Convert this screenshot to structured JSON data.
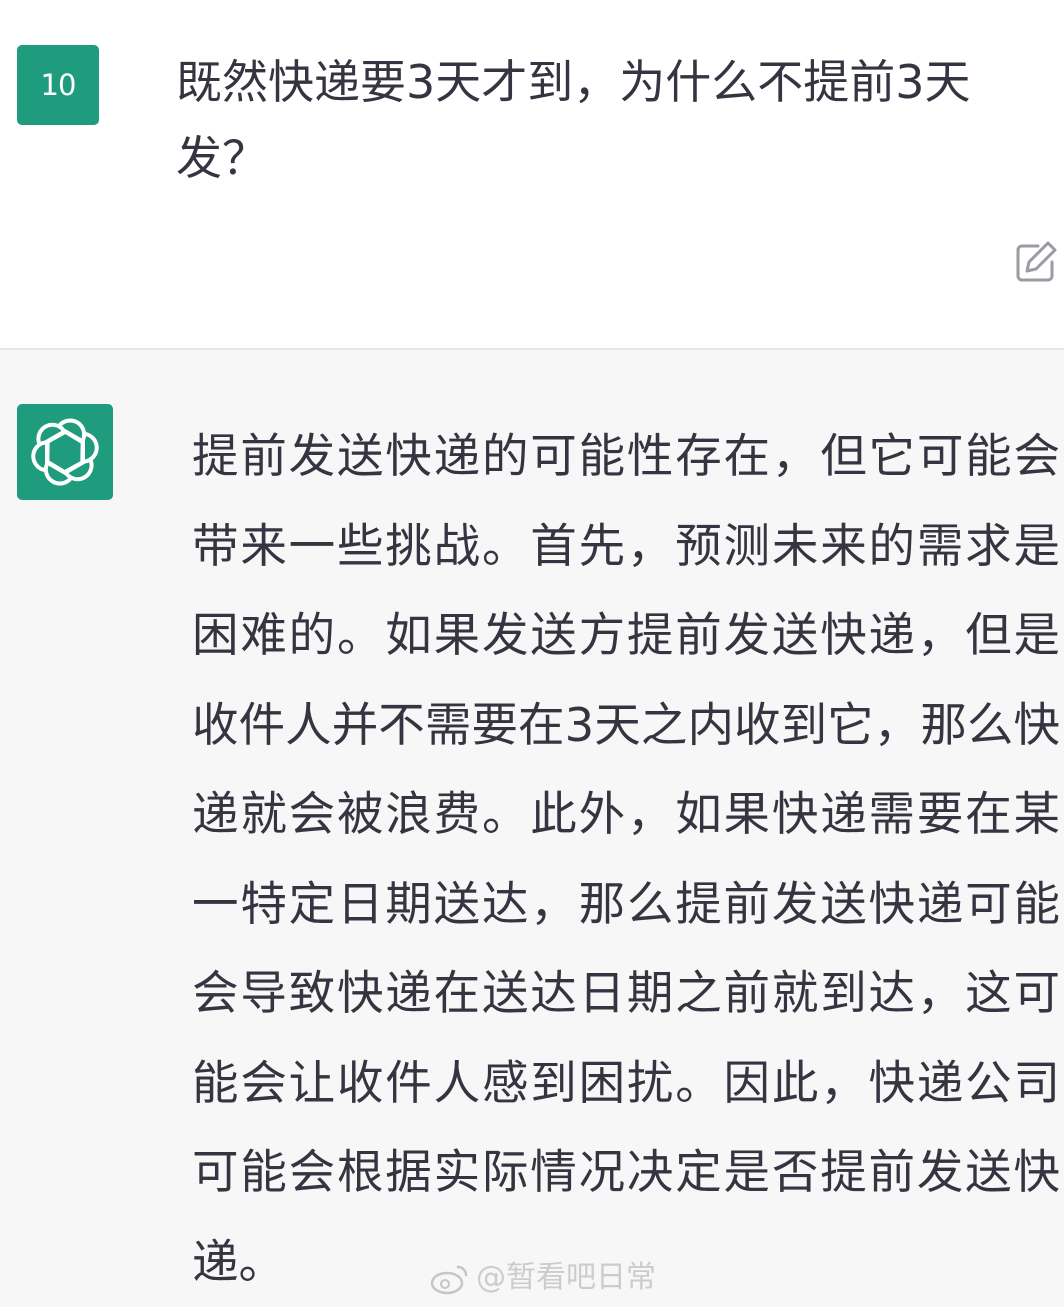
{
  "user": {
    "avatar_text": "10",
    "message": "既然快递要3天才到，为什么不提前3天发？",
    "edit_icon": "edit-icon"
  },
  "assistant": {
    "avatar_icon": "openai-logo-icon",
    "message": "提前发送快递的可能性存在，但它可能会带来一些挑战。首先，预测未来的需求是困难的。如果发送方提前发送快递，但是收件人并不需要在3天之内收到它，那么快递就会被浪费。此外，如果快递需要在某一特定日期送达，那么提前发送快递可能会导致快递在送达日期之前就到达，这可能会让收件人感到困扰。因此，快递公司可能会根据实际情况决定是否提前发送快递。"
  },
  "watermark": {
    "text": "@暂看吧日常",
    "icon": "weibo-icon"
  },
  "colors": {
    "accent": "#1f9c7d",
    "user_bg": "#ffffff",
    "assistant_bg": "#f7f7f8",
    "text": "#343541"
  }
}
